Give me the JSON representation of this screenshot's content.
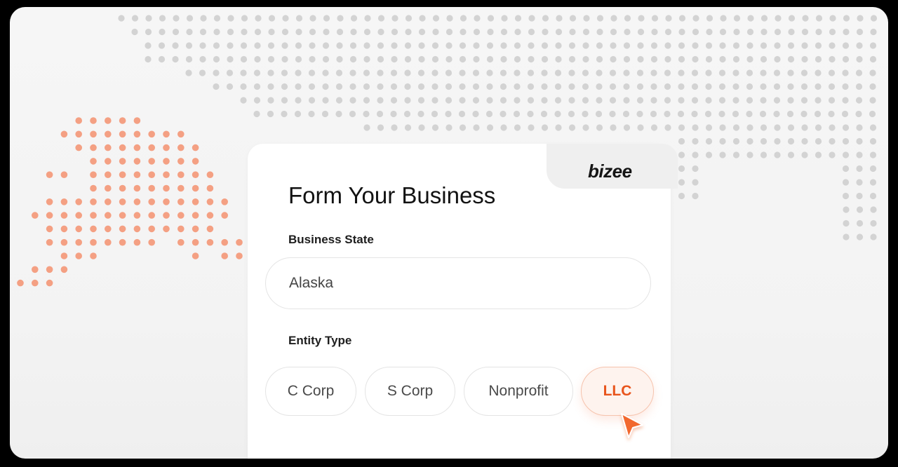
{
  "brand": {
    "logo_text": "bizee"
  },
  "form": {
    "title": "Form Your Business",
    "business_state_label": "Business State",
    "business_state_value": "Alaska",
    "entity_type_label": "Entity Type",
    "entity_types": [
      "C Corp",
      "S Corp",
      "Nonprofit",
      "LLC"
    ],
    "selected_entity_type": "LLC"
  },
  "colors": {
    "accent": "#e8541c",
    "alaska_dots": "#f4a083",
    "map_dots": "#d3d3d3"
  },
  "icons": {
    "cursor": "cursor-arrow-icon"
  }
}
